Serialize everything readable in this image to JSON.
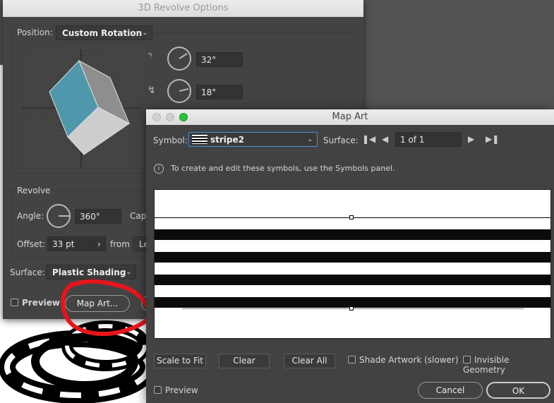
{
  "revolve_dialog": {
    "title": "3D Revolve Options",
    "position_label": "Position:",
    "position_value": "Custom Rotation",
    "rotation_x": "32°",
    "rotation_y": "18°",
    "revolve_heading": "Revolve",
    "angle_label": "Angle:",
    "angle_value": "360°",
    "cap_label": "Cap",
    "offset_label": "Offset:",
    "offset_value": "33 pt",
    "from_label": "from",
    "from_value": "Le",
    "surface_label": "Surface:",
    "surface_value": "Plastic Shading",
    "preview_label": "Preview",
    "preview_checked": false,
    "map_art_button": "Map Art...",
    "cube_face_color": "#4f97ab"
  },
  "map_art_dialog": {
    "title": "Map Art",
    "symbol_label": "Symbol:",
    "symbol_value": "stripe2",
    "surface_label": "Surface:",
    "surface_page": "1 of 1",
    "info_text": "To create and edit these symbols, use the Symbols panel.",
    "buttons": {
      "scale_to_fit": "Scale to Fit",
      "clear": "Clear",
      "clear_all": "Clear All",
      "cancel": "Cancel",
      "ok": "OK"
    },
    "shade_artwork_label": "Shade Artwork (slower)",
    "shade_artwork_checked": false,
    "invisible_geometry_label": "Invisible Geometry",
    "invisible_geometry_checked": false,
    "preview_label": "Preview",
    "preview_checked": false
  },
  "annotation_color": "#e8141c"
}
